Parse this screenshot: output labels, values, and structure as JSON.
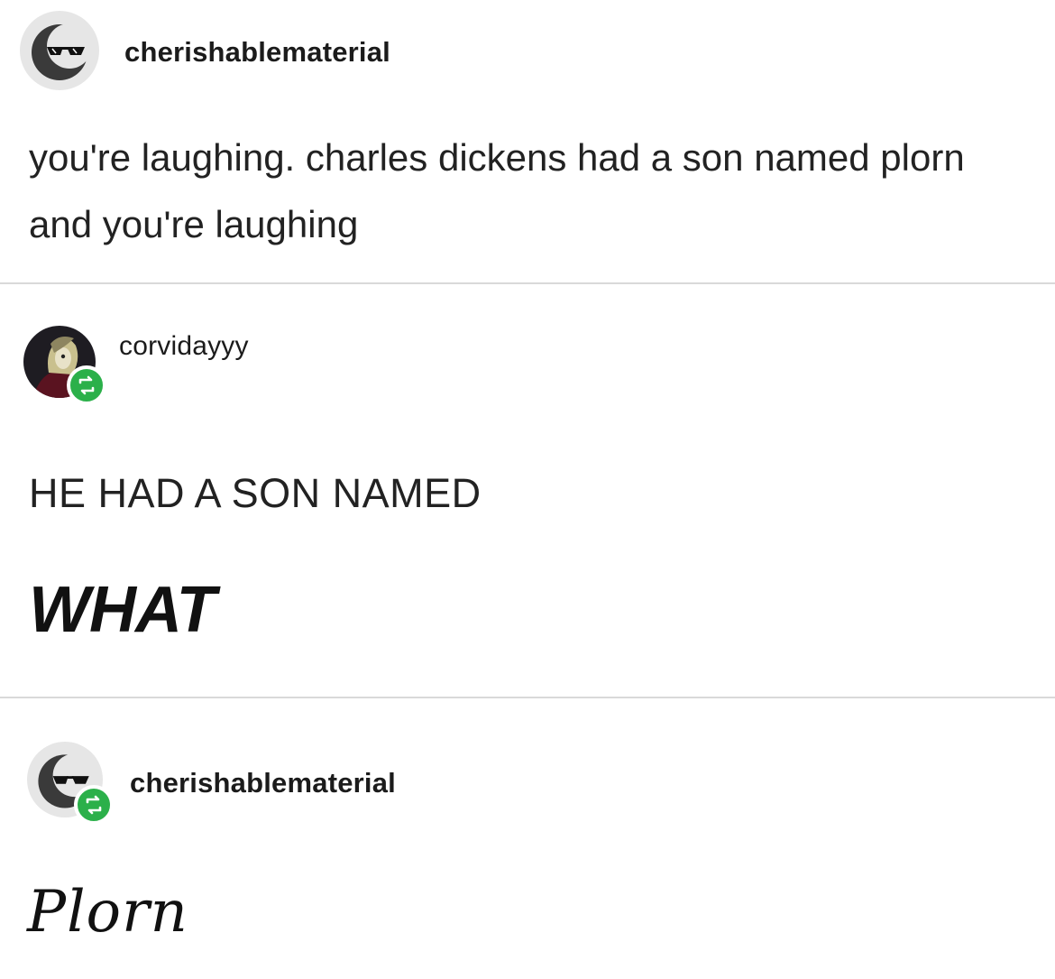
{
  "posts": [
    {
      "username": "cherishablematerial",
      "text": "you're laughing. charles dickens had a son named plorn and you're laughing",
      "reblog": false,
      "avatar_icon": "sunglasses-moon-icon"
    },
    {
      "username": "corvidayyy",
      "line1": "HE HAD A SON NAMED",
      "line2": "WHAT",
      "reblog": true,
      "avatar_icon": "character-portrait-icon"
    },
    {
      "username": "cherishablematerial",
      "text": "Plorn",
      "reblog": true,
      "avatar_icon": "sunglasses-moon-icon"
    }
  ],
  "colors": {
    "reblog_green": "#2bb04a",
    "divider": "#d9d9d9",
    "text": "#222222"
  }
}
